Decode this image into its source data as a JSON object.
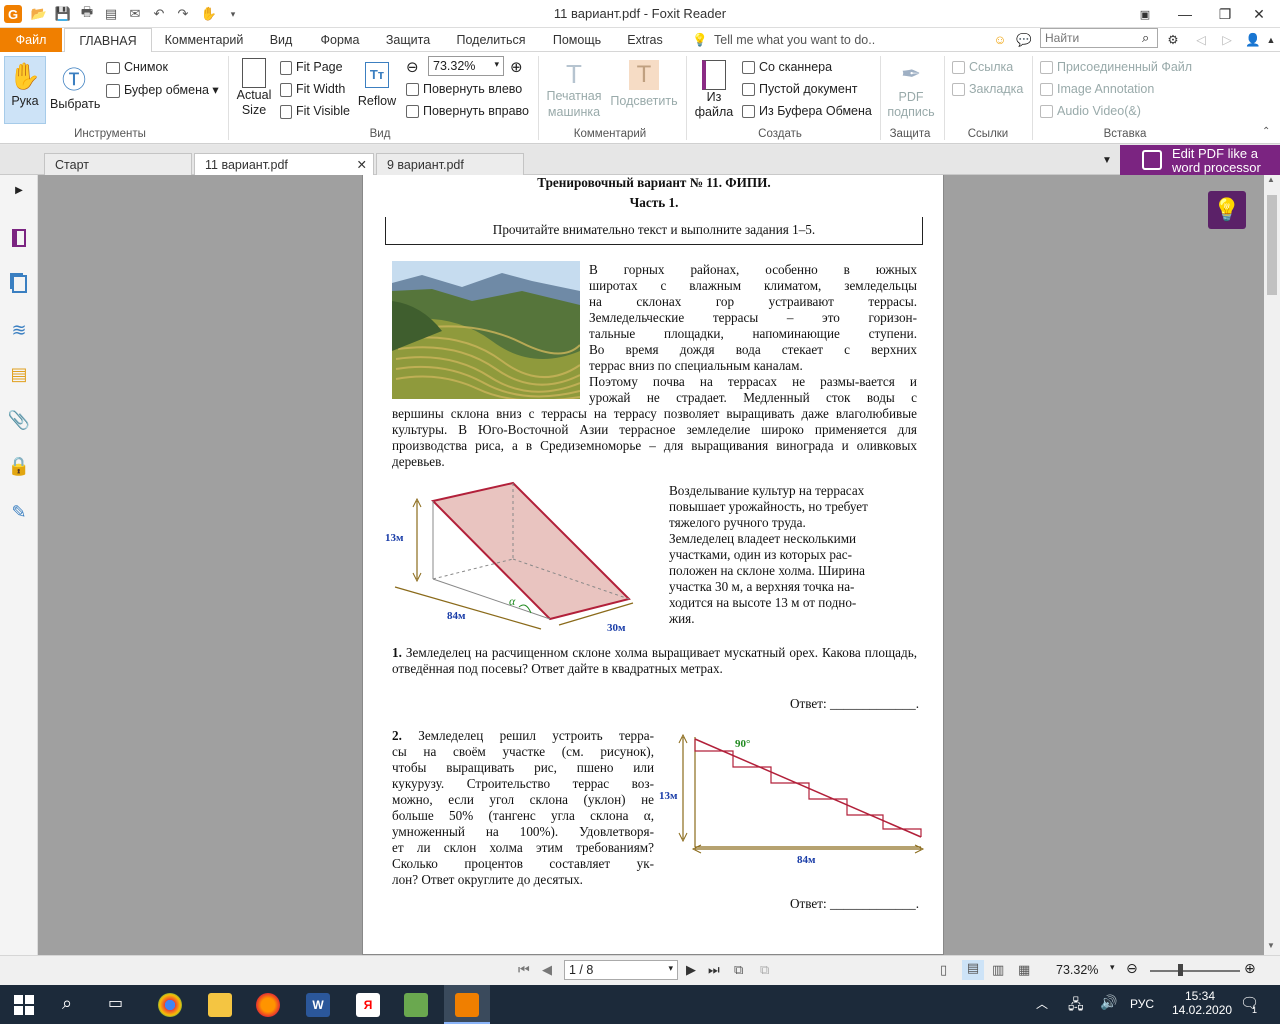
{
  "window": {
    "title": "11 вариант.pdf - Foxit Reader",
    "search_placeholder": "Найти"
  },
  "menu": {
    "file": "Файл",
    "tabs": [
      "ГЛАВНАЯ",
      "Комментарий",
      "Вид",
      "Форма",
      "Защита",
      "Поделиться",
      "Помощь",
      "Extras"
    ],
    "tell_me": "Tell me what you want to do.."
  },
  "ribbon": {
    "tools": {
      "hand": "Рука",
      "select": "Выбрать",
      "snapshot": "Снимок",
      "clipboard": "Буфер обмена",
      "group": "Инструменты"
    },
    "view": {
      "actual_size_1": "Actual",
      "actual_size_2": "Size",
      "fit_page": "Fit Page",
      "fit_width": "Fit Width",
      "fit_visible": "Fit Visible",
      "reflow": "Reflow",
      "zoom": "73.32%",
      "rotate_left": "Повернуть влево",
      "rotate_right": "Повернуть вправо",
      "group": "Вид"
    },
    "comment": {
      "typewriter_1": "Печатная",
      "typewriter_2": "машинка",
      "highlight": "Подсветить",
      "group": "Комментарий"
    },
    "create": {
      "from_file_1": "Из",
      "from_file_2": "файла",
      "scanner": "Со сканнера",
      "blank": "Пустой документ",
      "clipboard": "Из Буфера Обмена",
      "group": "Создать"
    },
    "protect": {
      "sign_1": "PDF",
      "sign_2": "подпись",
      "group": "Защита"
    },
    "links": {
      "link": "Ссылка",
      "bookmark": "Закладка",
      "group": "Ссылки"
    },
    "insert": {
      "attached": "Присоединенный Файл",
      "image_annot": "Image Annotation",
      "audio_video": "Audio  Video(&)",
      "group": "Вставка"
    }
  },
  "tabs": {
    "start": "Старт",
    "doc1": "11 вариант.pdf",
    "doc2": "9 вариант.pdf",
    "promo_1": "Edit PDF like a",
    "promo_2": "word processor"
  },
  "page": {
    "heading": "Тренировочный вариант № 11. ФИПИ.",
    "part": "Часть 1.",
    "instruction": "Прочитайте внимательно текст и выполните задания 1–5.",
    "para1_side": [
      "В горных районах, особенно в южных",
      "широтах с влажным климатом, земледельцы",
      "на склонах гор устраивают террасы.",
      "Земледельческие террасы – это горизон-",
      "тальные площадки, напоминающие ступени.",
      "Во время дождя вода стекает с верхних",
      "террас вниз по специальным каналам.",
      "Поэтому почва на террасах не размы-вается и",
      "урожай не страдает. Медленный сток воды с"
    ],
    "para1_full": "вершины склона вниз с террасы на террасу позволяет выращивать даже влаголюбивые культуры. В Юго-Восточной Азии террасное земледелие широко применяется для производства риса, а в Средиземноморье – для выращивания винограда и оливковых деревьев.",
    "para2": [
      "Возделывание культур на террасах",
      "повышает урожайность, но требует",
      "тяжелого ручного труда.",
      "Земледелец владеет несколькими",
      "участками, один из которых рас-",
      "положен на склоне холма. Ширина",
      "участка 30 м, а верхняя точка на-",
      "ходится на высоте 13 м от подно-",
      "жия."
    ],
    "fig1": {
      "height": "13м",
      "length": "84м",
      "width": "30м",
      "angle": "α"
    },
    "task1_num": "1.",
    "task1": "Земледелец на расчищенном склоне холма выращивает мускатный орех. Какова площадь, отведённая под посевы? Ответ дайте в квадратных метрах.",
    "answer_label": "Ответ: _____________.",
    "task2_num": "2.",
    "task2": [
      "Земледелец решил устроить терра-",
      "сы на своём участке (см. рисунок),",
      "чтобы выращивать рис, пшено или",
      "кукурузу. Строительство террас воз-",
      "можно, если угол склона (уклон) не",
      "больше 50% (тангенс угла склона α,",
      "умноженный на 100%). Удовлетворя-",
      "ет ли склон холма этим требованиям?",
      "Сколько процентов составляет ук-",
      "лон? Ответ округлите до десятых."
    ],
    "fig2": {
      "height": "13м",
      "length": "84м",
      "angle": "90°"
    }
  },
  "status": {
    "page": "1 / 8",
    "zoom": "73.32%"
  },
  "taskbar": {
    "lang": "РУС",
    "time": "15:34",
    "date": "14.02.2020",
    "notif": "1"
  }
}
